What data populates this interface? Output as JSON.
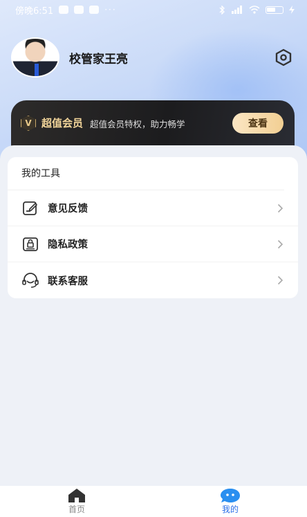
{
  "status_bar": {
    "time": "傍晚6:51",
    "dots": "···",
    "battery": "27"
  },
  "profile": {
    "name": "校管家王亮"
  },
  "vip": {
    "badge": "V",
    "title": "超值会员",
    "desc": "超值会员特权，助力畅学",
    "button": "查看"
  },
  "tools": {
    "title": "我的工具",
    "items": [
      {
        "label": "意见反馈",
        "icon": "feedback-icon"
      },
      {
        "label": "隐私政策",
        "icon": "privacy-lock-icon"
      },
      {
        "label": "联系客服",
        "icon": "customer-service-icon"
      }
    ]
  },
  "tabbar": {
    "tabs": [
      {
        "label": "首页",
        "icon": "home-icon",
        "active": false
      },
      {
        "label": "我的",
        "icon": "chat-bubble-icon",
        "active": true
      }
    ],
    "accent": "#2a6fe8"
  }
}
